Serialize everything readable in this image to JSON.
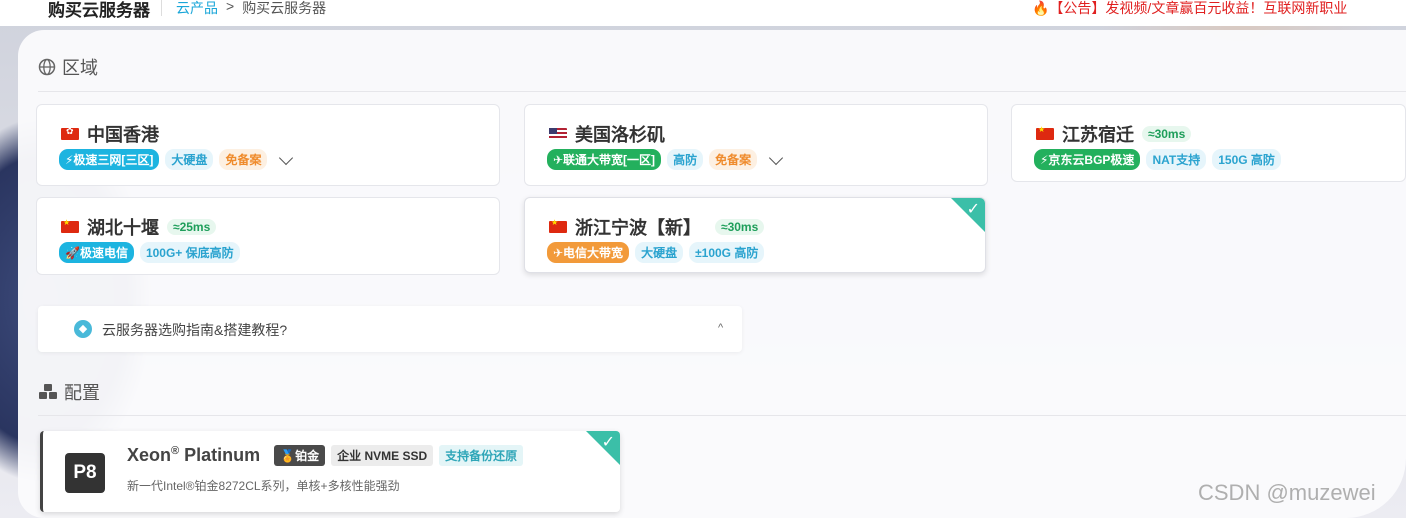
{
  "header": {
    "site_title": "购买云服务器",
    "breadcrumb": [
      {
        "label": "云产品",
        "link": true
      },
      {
        "label": "购买云服务器",
        "link": false
      }
    ],
    "breadcrumb_sep": ">",
    "notice": "🔥【公告】发视频/文章赢百元收益！互联网新职业"
  },
  "region": {
    "heading": "区域",
    "cards": [
      {
        "name": "中国香港",
        "flag": "hk",
        "latency": "",
        "tags": [
          {
            "text": "⚡极速三网[三区]",
            "style": "pill-blue"
          },
          {
            "text": "大硬盘",
            "style": "light-blue"
          },
          {
            "text": "免备案",
            "style": "light-orange"
          }
        ],
        "expandable": true,
        "selected": false
      },
      {
        "name": "美国洛杉矶",
        "flag": "us",
        "latency": "",
        "tags": [
          {
            "text": "✈联通大带宽[一区]",
            "style": "pill-green"
          },
          {
            "text": "高防",
            "style": "light-blue"
          },
          {
            "text": "免备案",
            "style": "light-orange"
          }
        ],
        "expandable": true,
        "selected": false
      },
      {
        "name": "江苏宿迁",
        "flag": "cn",
        "latency": "≈30ms",
        "tags": [
          {
            "text": "⚡京东云BGP极速",
            "style": "pill-green"
          },
          {
            "text": "NAT支持",
            "style": "light-blue"
          },
          {
            "text": "150G 高防",
            "style": "light-blue"
          }
        ],
        "expandable": false,
        "selected": false
      },
      {
        "name": "湖北十堰",
        "flag": "cn",
        "latency": "≈25ms",
        "tags": [
          {
            "text": "🚀极速电信",
            "style": "pill-blue"
          },
          {
            "text": "100G+ 保底高防",
            "style": "light-blue"
          }
        ],
        "expandable": false,
        "selected": false
      },
      {
        "name": "浙江宁波【新】",
        "flag": "cn",
        "latency": "≈30ms",
        "tags": [
          {
            "text": "✈电信大带宽",
            "style": "pill-orange"
          },
          {
            "text": "大硬盘",
            "style": "light-blue"
          },
          {
            "text": "±100G 高防",
            "style": "light-blue"
          }
        ],
        "expandable": false,
        "selected": true
      }
    ]
  },
  "guide": {
    "text": "云服务器选购指南&搭建教程?",
    "icon": "compass-icon",
    "caret": "^"
  },
  "config": {
    "heading": "配置",
    "card": {
      "badge": "P8",
      "title": "Xeon",
      "title_sup": "®",
      "title_rest": "Platinum",
      "tags": [
        {
          "text": "🏅铂金",
          "style": "dark"
        },
        {
          "text": "企业 NVME SSD",
          "style": "gray"
        },
        {
          "text": "支持备份还原",
          "style": "cyan"
        }
      ],
      "desc": "新一代Intel®铂金8272CL系列，单核+多核性能强劲",
      "selected": true
    }
  },
  "watermark": "CSDN @muzewei",
  "colors": {
    "accent": "#3bbfa8",
    "link": "#1aa6d8",
    "notice": "#e02020"
  }
}
